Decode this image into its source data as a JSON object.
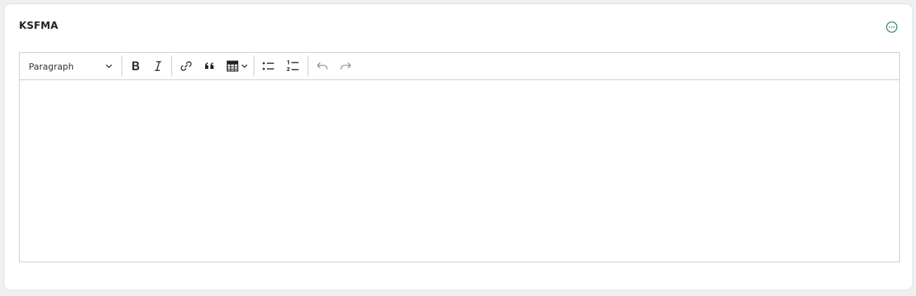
{
  "card": {
    "title": "KSFMA",
    "menu_icon": "more-horizontal-circle-icon",
    "accent_color": "#1f6f6a"
  },
  "editor": {
    "heading_select": {
      "selected": "Paragraph"
    },
    "toolbar": [
      {
        "name": "bold",
        "icon": "bold-icon"
      },
      {
        "name": "italic",
        "icon": "italic-icon"
      },
      {
        "name": "link",
        "icon": "link-icon"
      },
      {
        "name": "blockquote",
        "icon": "quote-icon"
      },
      {
        "name": "insert-table",
        "icon": "table-icon"
      },
      {
        "name": "bulleted-list",
        "icon": "bulleted-list-icon"
      },
      {
        "name": "numbered-list",
        "icon": "numbered-list-icon"
      },
      {
        "name": "undo",
        "icon": "undo-icon",
        "disabled": true
      },
      {
        "name": "redo",
        "icon": "redo-icon",
        "disabled": true
      }
    ],
    "content": ""
  }
}
